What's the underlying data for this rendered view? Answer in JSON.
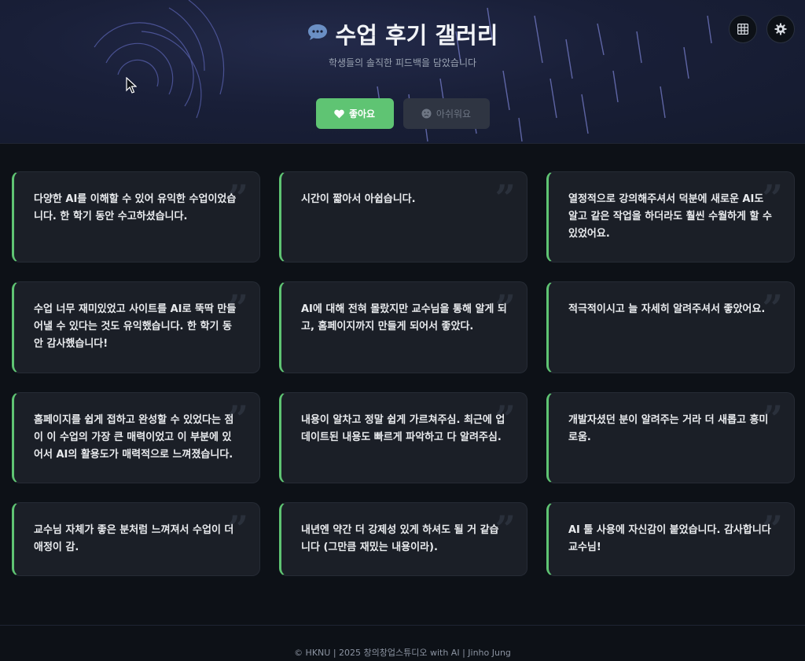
{
  "header": {
    "icon": "speech-bubble-icon",
    "title": "수업 후기 갤러리",
    "subtitle": "학생들의 솔직한 피드백을 담았습니다",
    "actions": [
      {
        "icon": "grid-icon"
      },
      {
        "icon": "settings-gear-icon"
      }
    ]
  },
  "tabs": {
    "like": {
      "label": "좋아요",
      "icon": "heart-icon",
      "active": true
    },
    "dislike": {
      "label": "아쉬워요",
      "icon": "sad-face-icon",
      "active": false
    }
  },
  "reviews": [
    {
      "text": "다양한 AI를 이해할 수 있어 유익한 수업이었습니다. 한 학기 동안 수고하셨습니다."
    },
    {
      "text": "시간이 짧아서 아쉽습니다."
    },
    {
      "text": "열정적으로 강의해주셔서 덕분에 새로운 AI도 알고 같은 작업을 하더라도 훨씬 수월하게 할 수 있었어요."
    },
    {
      "text": "수업 너무 재미있었고 사이트를 AI로 뚝딱 만들어낼 수 있다는 것도 유익했습니다. 한 학기 동안 감사했습니다!"
    },
    {
      "text": "AI에 대해 전혀 몰랐지만 교수님을 통해 알게 되고, 홈페이지까지 만들게 되어서 좋았다."
    },
    {
      "text": "적극적이시고 늘 자세히 알려주셔서 좋았어요."
    },
    {
      "text": "홈페이지를 쉽게 접하고 완성할 수 있었다는 점이 이 수업의 가장 큰 매력이었고 이 부분에 있어서 AI의 활용도가 매력적으로 느껴졌습니다."
    },
    {
      "text": "내용이 알차고 정말 쉽게 가르쳐주심. 최근에 업데이트된 내용도 빠르게 파악하고 다 알려주심."
    },
    {
      "text": "개발자셨던 분이 알려주는 거라 더 새롭고 흥미로움."
    },
    {
      "text": "교수님 자체가 좋은 분처럼 느껴져서 수업이 더 애정이 감."
    },
    {
      "text": "내년엔 약간 더 강제성 있게 하셔도 될 거 같습니다 (그만큼 재밌는 내용이라)."
    },
    {
      "text": "AI 툴 사용에 자신감이 붙었습니다. 감사합니다 교수님!"
    }
  ],
  "footer": {
    "text": "© HKNU | 2025 창의창업스튜디오 with AI | Jinho Jung"
  },
  "colors": {
    "accent": "#5fc473",
    "background": "#0d1117",
    "card": "#1b1f27"
  }
}
